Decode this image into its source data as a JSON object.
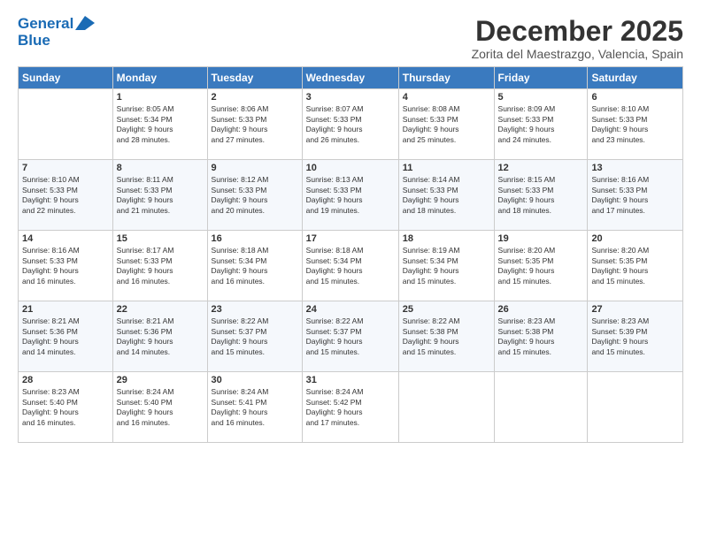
{
  "logo": {
    "line1": "General",
    "line2": "Blue"
  },
  "title": {
    "month": "December 2025",
    "location": "Zorita del Maestrazgo, Valencia, Spain"
  },
  "headers": [
    "Sunday",
    "Monday",
    "Tuesday",
    "Wednesday",
    "Thursday",
    "Friday",
    "Saturday"
  ],
  "weeks": [
    [
      {
        "day": "",
        "info": ""
      },
      {
        "day": "1",
        "info": "Sunrise: 8:05 AM\nSunset: 5:34 PM\nDaylight: 9 hours\nand 28 minutes."
      },
      {
        "day": "2",
        "info": "Sunrise: 8:06 AM\nSunset: 5:33 PM\nDaylight: 9 hours\nand 27 minutes."
      },
      {
        "day": "3",
        "info": "Sunrise: 8:07 AM\nSunset: 5:33 PM\nDaylight: 9 hours\nand 26 minutes."
      },
      {
        "day": "4",
        "info": "Sunrise: 8:08 AM\nSunset: 5:33 PM\nDaylight: 9 hours\nand 25 minutes."
      },
      {
        "day": "5",
        "info": "Sunrise: 8:09 AM\nSunset: 5:33 PM\nDaylight: 9 hours\nand 24 minutes."
      },
      {
        "day": "6",
        "info": "Sunrise: 8:10 AM\nSunset: 5:33 PM\nDaylight: 9 hours\nand 23 minutes."
      }
    ],
    [
      {
        "day": "7",
        "info": "Sunrise: 8:10 AM\nSunset: 5:33 PM\nDaylight: 9 hours\nand 22 minutes."
      },
      {
        "day": "8",
        "info": "Sunrise: 8:11 AM\nSunset: 5:33 PM\nDaylight: 9 hours\nand 21 minutes."
      },
      {
        "day": "9",
        "info": "Sunrise: 8:12 AM\nSunset: 5:33 PM\nDaylight: 9 hours\nand 20 minutes."
      },
      {
        "day": "10",
        "info": "Sunrise: 8:13 AM\nSunset: 5:33 PM\nDaylight: 9 hours\nand 19 minutes."
      },
      {
        "day": "11",
        "info": "Sunrise: 8:14 AM\nSunset: 5:33 PM\nDaylight: 9 hours\nand 18 minutes."
      },
      {
        "day": "12",
        "info": "Sunrise: 8:15 AM\nSunset: 5:33 PM\nDaylight: 9 hours\nand 18 minutes."
      },
      {
        "day": "13",
        "info": "Sunrise: 8:16 AM\nSunset: 5:33 PM\nDaylight: 9 hours\nand 17 minutes."
      }
    ],
    [
      {
        "day": "14",
        "info": "Sunrise: 8:16 AM\nSunset: 5:33 PM\nDaylight: 9 hours\nand 16 minutes."
      },
      {
        "day": "15",
        "info": "Sunrise: 8:17 AM\nSunset: 5:33 PM\nDaylight: 9 hours\nand 16 minutes."
      },
      {
        "day": "16",
        "info": "Sunrise: 8:18 AM\nSunset: 5:34 PM\nDaylight: 9 hours\nand 16 minutes."
      },
      {
        "day": "17",
        "info": "Sunrise: 8:18 AM\nSunset: 5:34 PM\nDaylight: 9 hours\nand 15 minutes."
      },
      {
        "day": "18",
        "info": "Sunrise: 8:19 AM\nSunset: 5:34 PM\nDaylight: 9 hours\nand 15 minutes."
      },
      {
        "day": "19",
        "info": "Sunrise: 8:20 AM\nSunset: 5:35 PM\nDaylight: 9 hours\nand 15 minutes."
      },
      {
        "day": "20",
        "info": "Sunrise: 8:20 AM\nSunset: 5:35 PM\nDaylight: 9 hours\nand 15 minutes."
      }
    ],
    [
      {
        "day": "21",
        "info": "Sunrise: 8:21 AM\nSunset: 5:36 PM\nDaylight: 9 hours\nand 14 minutes."
      },
      {
        "day": "22",
        "info": "Sunrise: 8:21 AM\nSunset: 5:36 PM\nDaylight: 9 hours\nand 14 minutes."
      },
      {
        "day": "23",
        "info": "Sunrise: 8:22 AM\nSunset: 5:37 PM\nDaylight: 9 hours\nand 15 minutes."
      },
      {
        "day": "24",
        "info": "Sunrise: 8:22 AM\nSunset: 5:37 PM\nDaylight: 9 hours\nand 15 minutes."
      },
      {
        "day": "25",
        "info": "Sunrise: 8:22 AM\nSunset: 5:38 PM\nDaylight: 9 hours\nand 15 minutes."
      },
      {
        "day": "26",
        "info": "Sunrise: 8:23 AM\nSunset: 5:38 PM\nDaylight: 9 hours\nand 15 minutes."
      },
      {
        "day": "27",
        "info": "Sunrise: 8:23 AM\nSunset: 5:39 PM\nDaylight: 9 hours\nand 15 minutes."
      }
    ],
    [
      {
        "day": "28",
        "info": "Sunrise: 8:23 AM\nSunset: 5:40 PM\nDaylight: 9 hours\nand 16 minutes."
      },
      {
        "day": "29",
        "info": "Sunrise: 8:24 AM\nSunset: 5:40 PM\nDaylight: 9 hours\nand 16 minutes."
      },
      {
        "day": "30",
        "info": "Sunrise: 8:24 AM\nSunset: 5:41 PM\nDaylight: 9 hours\nand 16 minutes."
      },
      {
        "day": "31",
        "info": "Sunrise: 8:24 AM\nSunset: 5:42 PM\nDaylight: 9 hours\nand 17 minutes."
      },
      {
        "day": "",
        "info": ""
      },
      {
        "day": "",
        "info": ""
      },
      {
        "day": "",
        "info": ""
      }
    ]
  ]
}
